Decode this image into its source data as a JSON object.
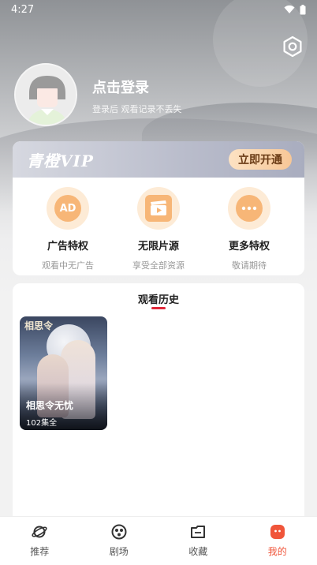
{
  "status_bar": {
    "time": "4:27"
  },
  "user": {
    "login_title": "点击登录",
    "login_subtitle": "登录后 观看记录不丢失"
  },
  "vip": {
    "logo": "青橙VIP",
    "open_button": "立即开通",
    "perks": [
      {
        "icon": "ad-icon",
        "icon_text": "AD",
        "title": "广告特权",
        "subtitle": "观看中无广告"
      },
      {
        "icon": "clapperboard-icon",
        "title": "无限片源",
        "subtitle": "享受全部资源"
      },
      {
        "icon": "more-icon",
        "title": "更多特权",
        "subtitle": "敬请期待"
      }
    ]
  },
  "history": {
    "title": "观看历史",
    "items": [
      {
        "title": "相思令无忧",
        "poster_text": "相思令",
        "episodes": "102集全"
      }
    ]
  },
  "tabbar": {
    "items": [
      {
        "icon": "planet-icon",
        "label": "推荐"
      },
      {
        "icon": "theater-icon",
        "label": "剧场"
      },
      {
        "icon": "folder-icon",
        "label": "收藏"
      },
      {
        "icon": "profile-icon",
        "label": "我的",
        "active": true
      }
    ]
  },
  "colors": {
    "accent": "#f0553a",
    "underline": "#e0283a",
    "perk_bg": "#fdebd6",
    "perk_icon": "#f7b677"
  }
}
